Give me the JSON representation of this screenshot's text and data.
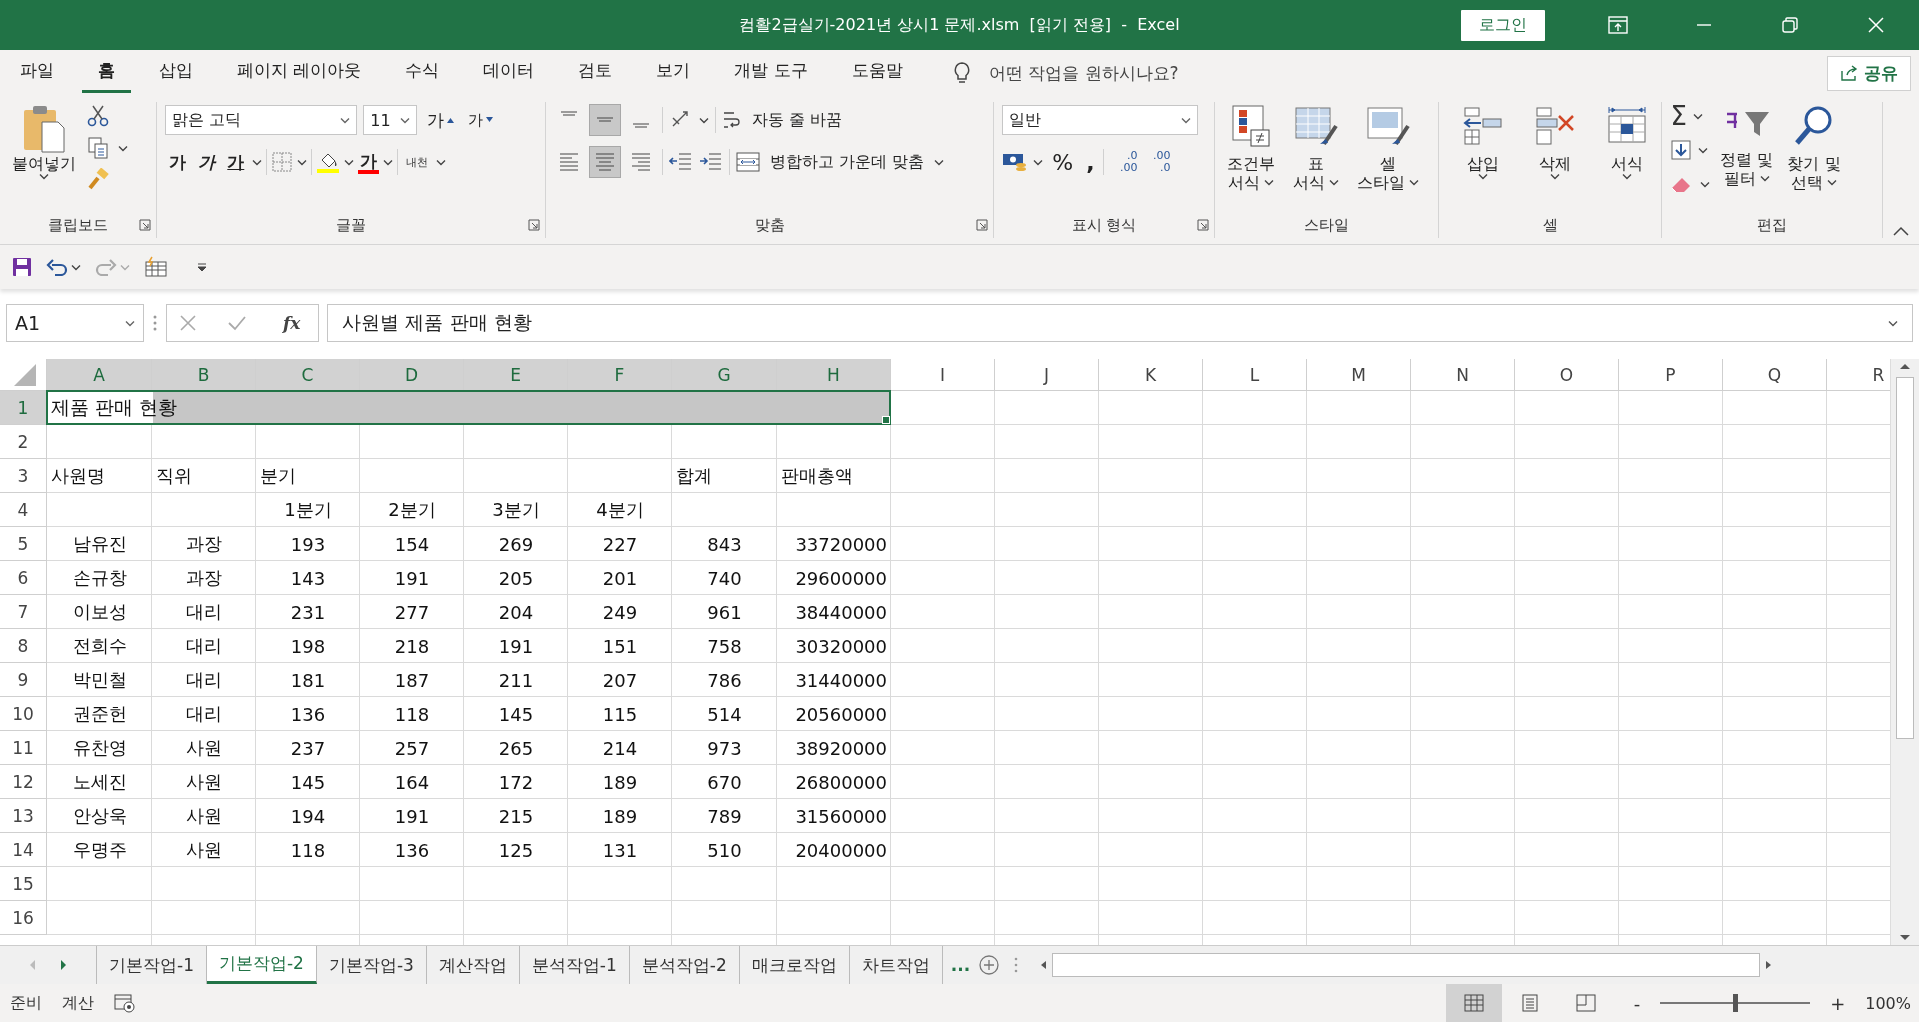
{
  "window": {
    "title": "컴활2급실기-2021년 상시1 문제.xlsm  [읽기 전용]  -  Excel",
    "sign_in": "로그인"
  },
  "menu_tabs": [
    {
      "label": "파일",
      "selected": false
    },
    {
      "label": "홈",
      "selected": true
    },
    {
      "label": "삽입",
      "selected": false
    },
    {
      "label": "페이지 레이아웃",
      "selected": false
    },
    {
      "label": "수식",
      "selected": false
    },
    {
      "label": "데이터",
      "selected": false
    },
    {
      "label": "검토",
      "selected": false
    },
    {
      "label": "보기",
      "selected": false
    },
    {
      "label": "개발 도구",
      "selected": false
    },
    {
      "label": "도움말",
      "selected": false
    }
  ],
  "tell_me": {
    "placeholder": "어떤 작업을 원하시나요?"
  },
  "share": "공유",
  "ribbon": {
    "clipboard": {
      "label": "클립보드",
      "paste": "붙여넣기"
    },
    "font": {
      "label": "글꼴",
      "font_name": "맑은 고딕",
      "font_size": "11",
      "grow": "가",
      "shrink": "가",
      "bold": "가",
      "italic": "가",
      "underline": "가",
      "font_color": "가",
      "phonetic": "내천"
    },
    "alignment": {
      "label": "맞춤",
      "vertical": [
        {
          "selected": false
        },
        {
          "selected": true
        },
        {
          "selected": false
        }
      ],
      "horizontal": [
        {
          "selected": false
        },
        {
          "selected": true
        },
        {
          "selected": false
        }
      ],
      "wrap": "자동 줄 바꿈",
      "merge": "병합하고 가운데 맞춤"
    },
    "number": {
      "label": "표시 형식",
      "format": "일반",
      "percent": "%",
      "comma": ",",
      "increase_decimal": [
        ".0",
        ".00"
      ],
      "decrease_decimal": [
        ".00",
        ".0"
      ]
    },
    "styles": {
      "label": "스타일",
      "buttons": [
        [
          "조건부",
          "서식"
        ],
        [
          "표",
          "서식"
        ],
        [
          "셀",
          "스타일"
        ]
      ]
    },
    "cells": {
      "label": "셀",
      "buttons": [
        "삽입",
        "삭제",
        "서식"
      ]
    },
    "editing": {
      "label": "편집",
      "autosum": "Σ",
      "buttons": [
        [
          "정렬 및",
          "필터"
        ],
        [
          "찾기 및",
          "선택"
        ]
      ]
    }
  },
  "formula_bar": {
    "name_box": "A1",
    "fx": "fx",
    "formula": "사원별 제품 판매 현황"
  },
  "sheet": {
    "columns": [
      {
        "label": "A",
        "selected": true
      },
      {
        "label": "B",
        "selected": true
      },
      {
        "label": "C",
        "selected": true
      },
      {
        "label": "D",
        "selected": true
      },
      {
        "label": "E",
        "selected": true
      },
      {
        "label": "F",
        "selected": true
      },
      {
        "label": "G",
        "selected": true
      },
      {
        "label": "H",
        "selected": true
      },
      {
        "label": "I",
        "selected": false
      },
      {
        "label": "J",
        "selected": false
      },
      {
        "label": "K",
        "selected": false
      },
      {
        "label": "L",
        "selected": false
      },
      {
        "label": "M",
        "selected": false
      },
      {
        "label": "N",
        "selected": false
      },
      {
        "label": "O",
        "selected": false
      },
      {
        "label": "P",
        "selected": false
      },
      {
        "label": "Q",
        "selected": false
      },
      {
        "label": "R",
        "selected": false
      }
    ],
    "rows": [
      {
        "number": "1",
        "selected": true,
        "kind": "title",
        "A": "제품 판매 현황"
      },
      {
        "number": "2",
        "selected": false,
        "kind": "header"
      },
      {
        "number": "3",
        "selected": false,
        "kind": "header",
        "A": "사원명",
        "B": "직위",
        "C": "분기",
        "G": "합계",
        "H": "판매총액"
      },
      {
        "number": "4",
        "selected": false,
        "kind": "data",
        "C": "1분기",
        "D": "2분기",
        "E": "3분기",
        "F": "4분기"
      },
      {
        "number": "5",
        "selected": false,
        "kind": "data",
        "A": "남유진",
        "B": "과장",
        "C": "193",
        "D": "154",
        "E": "269",
        "F": "227",
        "G": "843",
        "H": "33720000"
      },
      {
        "number": "6",
        "selected": false,
        "kind": "data",
        "A": "손규창",
        "B": "과장",
        "C": "143",
        "D": "191",
        "E": "205",
        "F": "201",
        "G": "740",
        "H": "29600000"
      },
      {
        "number": "7",
        "selected": false,
        "kind": "data",
        "A": "이보성",
        "B": "대리",
        "C": "231",
        "D": "277",
        "E": "204",
        "F": "249",
        "G": "961",
        "H": "38440000"
      },
      {
        "number": "8",
        "selected": false,
        "kind": "data",
        "A": "전희수",
        "B": "대리",
        "C": "198",
        "D": "218",
        "E": "191",
        "F": "151",
        "G": "758",
        "H": "30320000"
      },
      {
        "number": "9",
        "selected": false,
        "kind": "data",
        "A": "박민철",
        "B": "대리",
        "C": "181",
        "D": "187",
        "E": "211",
        "F": "207",
        "G": "786",
        "H": "31440000"
      },
      {
        "number": "10",
        "selected": false,
        "kind": "data",
        "A": "권준헌",
        "B": "대리",
        "C": "136",
        "D": "118",
        "E": "145",
        "F": "115",
        "G": "514",
        "H": "20560000"
      },
      {
        "number": "11",
        "selected": false,
        "kind": "data",
        "A": "유찬영",
        "B": "사원",
        "C": "237",
        "D": "257",
        "E": "265",
        "F": "214",
        "G": "973",
        "H": "38920000"
      },
      {
        "number": "12",
        "selected": false,
        "kind": "data",
        "A": "노세진",
        "B": "사원",
        "C": "145",
        "D": "164",
        "E": "172",
        "F": "189",
        "G": "670",
        "H": "26800000"
      },
      {
        "number": "13",
        "selected": false,
        "kind": "data",
        "A": "안상욱",
        "B": "사원",
        "C": "194",
        "D": "191",
        "E": "215",
        "F": "189",
        "G": "789",
        "H": "31560000"
      },
      {
        "number": "14",
        "selected": false,
        "kind": "data",
        "A": "우명주",
        "B": "사원",
        "C": "118",
        "D": "136",
        "E": "125",
        "F": "131",
        "G": "510",
        "H": "20400000"
      },
      {
        "number": "15",
        "selected": false,
        "kind": "data"
      },
      {
        "number": "16",
        "selected": false,
        "kind": "data"
      }
    ]
  },
  "sheet_tabs": [
    {
      "label": "기본작업-1",
      "selected": false
    },
    {
      "label": "기본작업-2",
      "selected": true
    },
    {
      "label": "기본작업-3",
      "selected": false
    },
    {
      "label": "계산작업",
      "selected": false
    },
    {
      "label": "분석작업-1",
      "selected": false
    },
    {
      "label": "분석작업-2",
      "selected": false
    },
    {
      "label": "매크로작업",
      "selected": false
    },
    {
      "label": "차트작업",
      "selected": false
    }
  ],
  "more_tabs": "...",
  "status_bar": {
    "ready": "준비",
    "calc": "계산",
    "views": [
      {
        "selected": true
      },
      {
        "selected": false
      },
      {
        "selected": false
      }
    ],
    "zoom_out": "-",
    "zoom_in": "+",
    "zoom": {
      "level": 0.5
    },
    "zoom_text": "100%"
  }
}
